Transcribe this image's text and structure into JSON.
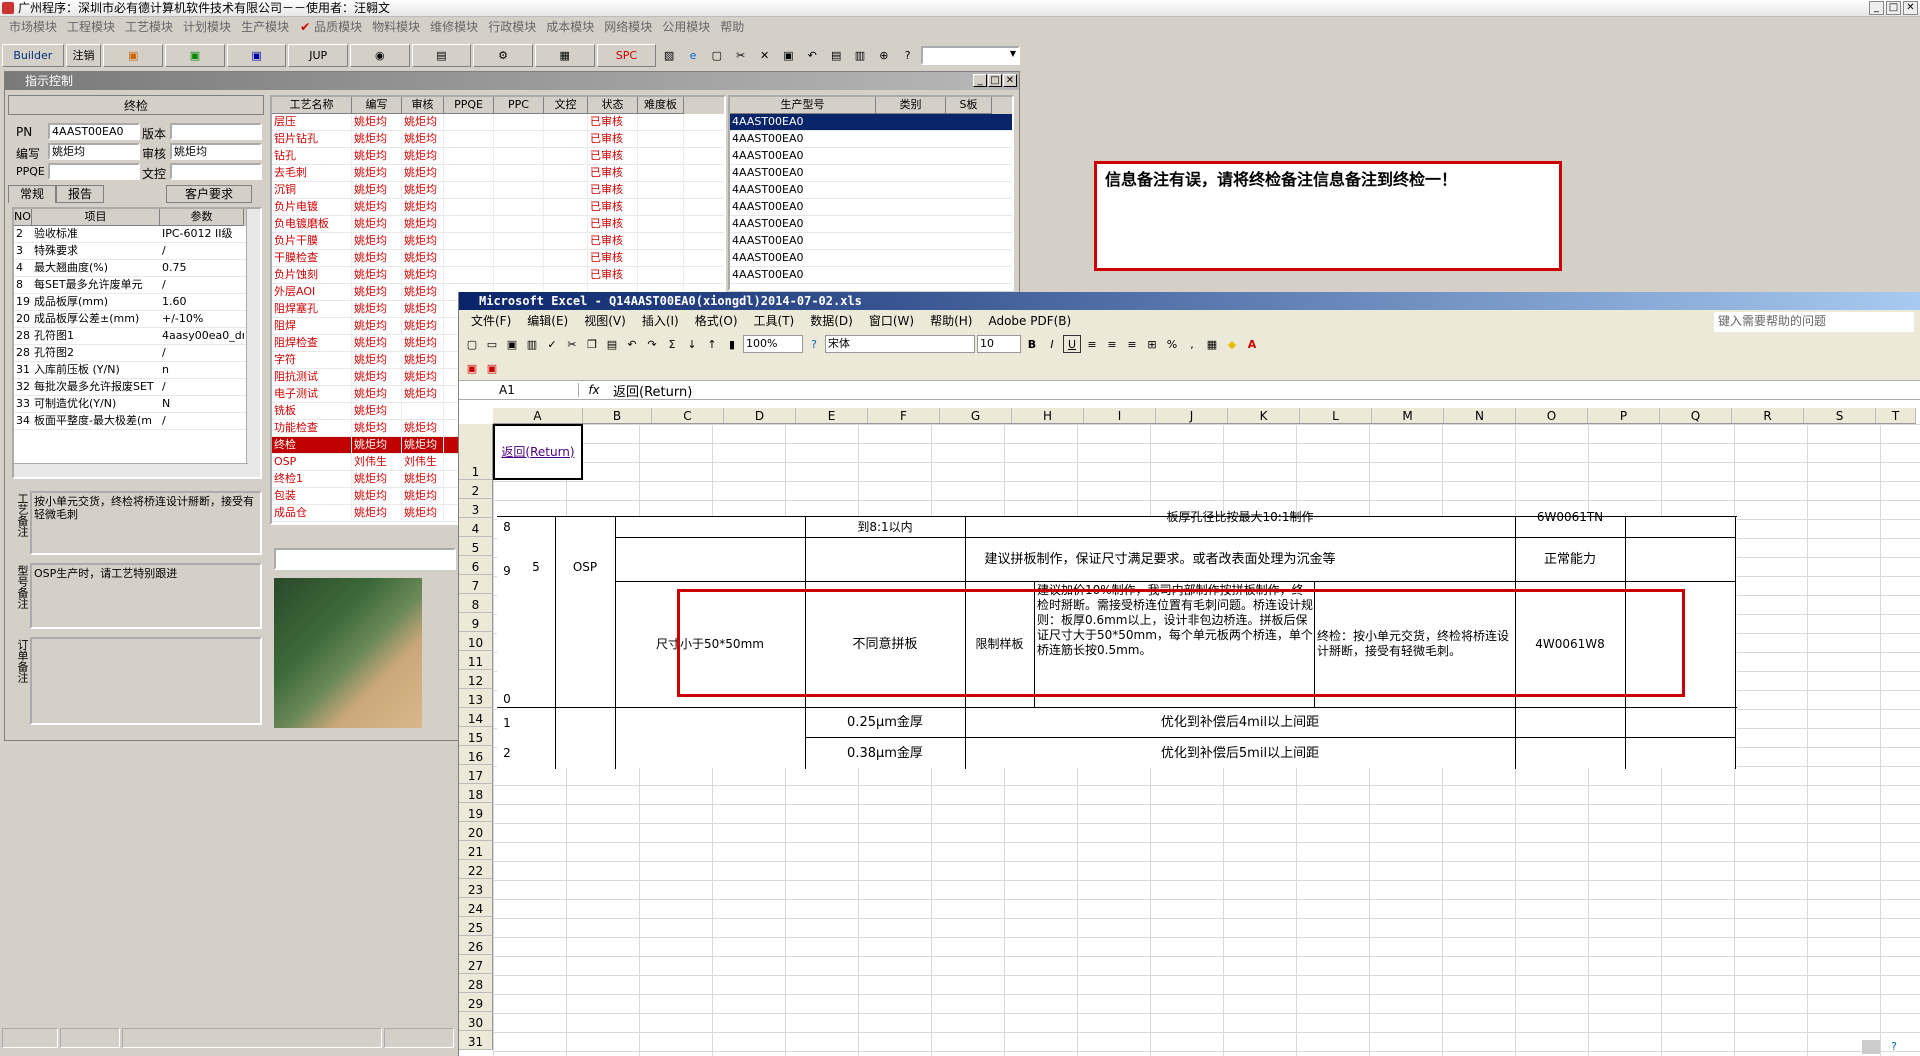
{
  "window": {
    "title": "广州程序：深圳市必有德计算机软件技术有限公司－－使用者：汪翱文"
  },
  "menubar": [
    "市场模块",
    "工程模块",
    "工艺模块",
    "计划模块",
    "生产模块",
    "品质模块",
    "物料模块",
    "维修模块",
    "行政模块",
    "成本模块",
    "网络模块",
    "公用模块",
    "帮助"
  ],
  "toolbar": {
    "builder": "Builder",
    "logout": "注销",
    "jup": "JUP",
    "spc": "SPC"
  },
  "inner": {
    "title": "指示控制"
  },
  "left": {
    "header": "终检",
    "pn_label": "PN",
    "pn_value": "4AAST00EA0",
    "version_label": "版本",
    "version_value": "",
    "author_label": "编写",
    "author_value": "姚炬均",
    "review_label": "审核",
    "review_value": "姚炬均",
    "ppqe_label": "PPQE",
    "ppqe_value": "",
    "doc_label": "文控",
    "doc_value": "",
    "tabs": [
      "常规",
      "报告",
      "客户要求"
    ],
    "grid_head": [
      "NO",
      "项目",
      "参数"
    ],
    "grid_rows": [
      [
        "2",
        "验收标准",
        "IPC-6012 II级"
      ],
      [
        "3",
        "特殊要求",
        "/"
      ],
      [
        "4",
        "最大翘曲度(%)",
        "0.75"
      ],
      [
        "8",
        "每SET最多允许废单元",
        "/"
      ],
      [
        "19",
        "成品板厚(mm)",
        "1.60"
      ],
      [
        "20",
        "成品板厚公差±(mm)",
        "+/-10%"
      ],
      [
        "28",
        "孔符图1",
        "4aasy00ea0_dr"
      ],
      [
        "28",
        "孔符图2",
        "/"
      ],
      [
        "31",
        "入库前压板 (Y/N)",
        "n"
      ],
      [
        "32",
        "每批次最多允许报废SET",
        "/"
      ],
      [
        "33",
        "可制造优化(Y/N)",
        "N"
      ],
      [
        "34",
        "板面平整度-最大极差(m",
        "/"
      ]
    ],
    "memo1_label": "工艺备注",
    "memo1": "按小单元交货，终检将桥连设计掰断，接受有轻微毛刺",
    "memo2_label": "型号备注",
    "memo2": "OSP生产时，请工艺特别跟进",
    "memo3_label": "订单备注",
    "memo3": ""
  },
  "process": {
    "head": [
      "工艺名称",
      "编写",
      "审核",
      "PPQE",
      "PPC",
      "文控",
      "状态",
      "难度板"
    ],
    "rows": [
      [
        "层压",
        "姚炬均",
        "姚炬均",
        "已审核"
      ],
      [
        "铝片钻孔",
        "姚炬均",
        "姚炬均",
        "已审核"
      ],
      [
        "钻孔",
        "姚炬均",
        "姚炬均",
        "已审核"
      ],
      [
        "去毛刺",
        "姚炬均",
        "姚炬均",
        "已审核"
      ],
      [
        "沉铜",
        "姚炬均",
        "姚炬均",
        "已审核"
      ],
      [
        "负片电镀",
        "姚炬均",
        "姚炬均",
        "已审核"
      ],
      [
        "负电镀磨板",
        "姚炬均",
        "姚炬均",
        "已审核"
      ],
      [
        "负片干膜",
        "姚炬均",
        "姚炬均",
        "已审核"
      ],
      [
        "干膜检查",
        "姚炬均",
        "姚炬均",
        "已审核"
      ],
      [
        "负片蚀刻",
        "姚炬均",
        "姚炬均",
        "已审核"
      ],
      [
        "外层AOI",
        "姚炬均",
        "姚炬均",
        ""
      ],
      [
        "阻焊塞孔",
        "姚炬均",
        "姚炬均",
        ""
      ],
      [
        "阻焊",
        "姚炬均",
        "姚炬均",
        ""
      ],
      [
        "阻焊检查",
        "姚炬均",
        "姚炬均",
        ""
      ],
      [
        "字符",
        "姚炬均",
        "姚炬均",
        ""
      ],
      [
        "阻抗测试",
        "姚炬均",
        "姚炬均",
        ""
      ],
      [
        "电子测试",
        "姚炬均",
        "姚炬均",
        ""
      ],
      [
        "铣板",
        "姚炬均",
        "",
        ""
      ],
      [
        "功能检查",
        "姚炬均",
        "姚炬均",
        ""
      ],
      [
        "终检",
        "姚炬均",
        "姚炬均",
        ""
      ],
      [
        "OSP",
        "刘伟生",
        "刘伟生",
        ""
      ],
      [
        "终检1",
        "姚炬均",
        "姚炬均",
        ""
      ],
      [
        "包装",
        "姚炬均",
        "姚炬均",
        ""
      ],
      [
        "成品仓",
        "姚炬均",
        "姚炬均",
        ""
      ]
    ]
  },
  "models": {
    "head": [
      "生产型号",
      "类别",
      "S板"
    ],
    "rows": [
      "4AAST00EA0",
      "4AAST00EA0",
      "4AAST00EA0",
      "4AAST00EA0",
      "4AAST00EA0",
      "4AAST00EA0",
      "4AAST00EA0",
      "4AAST00EA0",
      "4AAST00EA0",
      "4AAST00EA0"
    ]
  },
  "popup": {
    "text": "信息备注有误，请将终检备注信息备注到终检一！"
  },
  "excel": {
    "title": "Microsoft Excel - Q14AAST00EA0(xiongdl)2014-07-02.xls",
    "menu": [
      "文件(F)",
      "编辑(E)",
      "视图(V)",
      "插入(I)",
      "格式(O)",
      "工具(T)",
      "数据(D)",
      "窗口(W)",
      "帮助(H)",
      "Adobe PDF(B)"
    ],
    "help_placeholder": "键入需要帮助的问题",
    "zoom": "100%",
    "font": "宋体",
    "size": "10",
    "namebox": "A1",
    "fx": "fx",
    "formula": "返回(Return)",
    "columns": [
      "A",
      "B",
      "C",
      "D",
      "E",
      "F",
      "G",
      "H",
      "I",
      "J",
      "K",
      "L",
      "M",
      "N",
      "O",
      "P",
      "Q",
      "R",
      "S",
      "T"
    ],
    "rows": [
      "1",
      "2",
      "3",
      "4",
      "5",
      "6",
      "7",
      "8",
      "9",
      "10",
      "11",
      "12",
      "13",
      "14",
      "15",
      "16",
      "17",
      "18",
      "19",
      "20",
      "21",
      "22",
      "23",
      "24",
      "25",
      "26",
      "27",
      "28",
      "29",
      "30",
      "31"
    ],
    "a1": "返回(Return)",
    "c_row_nums": [
      "8",
      "9",
      "0",
      "1",
      "2"
    ],
    "c_no": "5",
    "c_proc": "OSP",
    "c_top1": "到8:1以内",
    "c_top2": "板厚孔径比按最大10:1制作",
    "c_top3": "6W0061TN",
    "c_r1": "建议拼板制作，保证尺寸满足要求。或者改表面处理为沉金等",
    "c_r1b": "正常能力",
    "c_item": "尺寸小于50*50mm",
    "c_disagree": "不同意拼板",
    "c_limit": "限制样板",
    "c_desc": "建议加价10%制作，我司内部制作按拼板制作，终检时掰断。需接受桥连位置有毛刺问题。桥连设计规则：板厚0.6mm以上，设计非包边桥连。拼板后保证尺寸大于50*50mm，每个单元板两个桥连，单个桥连筋长按0.5mm。",
    "c_final": "终检：按小单元交货，终检将桥连设计掰断，接受有轻微毛刺。",
    "c_code": "4W0061W8",
    "c_g1": "0.25μm金厚",
    "c_g1b": "优化到补偿后4mil以上间距",
    "c_g2": "0.38μm金厚",
    "c_g2b": "优化到补偿后5mil以上间距"
  }
}
